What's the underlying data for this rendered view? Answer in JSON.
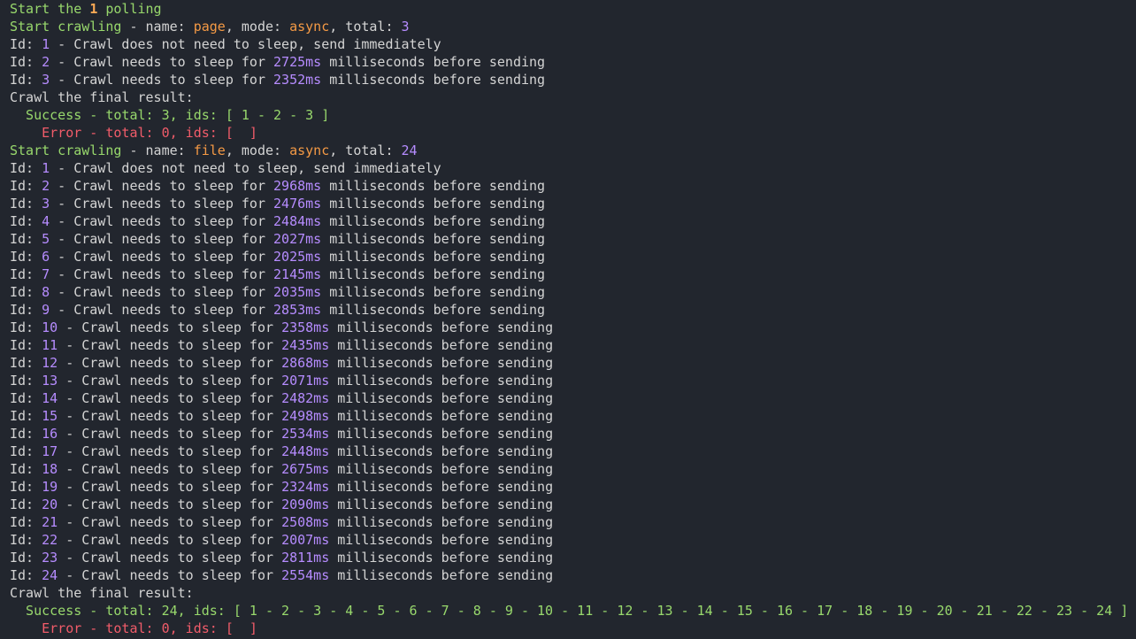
{
  "terminal": {
    "lines": [
      [
        [
          "Start the ",
          "green"
        ],
        [
          "1",
          "orange"
        ],
        [
          " polling",
          "green"
        ]
      ],
      [
        [
          "Start crawling",
          "green"
        ],
        [
          " - name: ",
          "plain"
        ],
        [
          "page",
          "orange-plain"
        ],
        [
          ", mode: ",
          "plain"
        ],
        [
          "async",
          "orange-plain"
        ],
        [
          ", total: ",
          "plain"
        ],
        [
          "3",
          "purple"
        ]
      ],
      [
        [
          "Id: ",
          "plain"
        ],
        [
          "1",
          "purple"
        ],
        [
          " - Crawl does not need to sleep, send immediately",
          "plain"
        ]
      ],
      [
        [
          "Id: ",
          "plain"
        ],
        [
          "2",
          "purple"
        ],
        [
          " - Crawl needs to sleep for ",
          "plain"
        ],
        [
          "2725ms",
          "purple"
        ],
        [
          " milliseconds before sending",
          "plain"
        ]
      ],
      [
        [
          "Id: ",
          "plain"
        ],
        [
          "3",
          "purple"
        ],
        [
          " - Crawl needs to sleep for ",
          "plain"
        ],
        [
          "2352ms",
          "purple"
        ],
        [
          " milliseconds before sending",
          "plain"
        ]
      ],
      [
        [
          "Crawl the final result:",
          "plain"
        ]
      ],
      [
        [
          "  Success - total: 3, ids: [ 1 - 2 - 3 ]",
          "green"
        ]
      ],
      [
        [
          "    Error - total: 0, ids: [  ]",
          "red"
        ]
      ],
      [
        [
          "Start crawling",
          "green"
        ],
        [
          " - name: ",
          "plain"
        ],
        [
          "file",
          "orange-plain"
        ],
        [
          ", mode: ",
          "plain"
        ],
        [
          "async",
          "orange-plain"
        ],
        [
          ", total: ",
          "plain"
        ],
        [
          "24",
          "purple"
        ]
      ],
      [
        [
          "Id: ",
          "plain"
        ],
        [
          "1",
          "purple"
        ],
        [
          " - Crawl does not need to sleep, send immediately",
          "plain"
        ]
      ],
      [
        [
          "Id: ",
          "plain"
        ],
        [
          "2",
          "purple"
        ],
        [
          " - Crawl needs to sleep for ",
          "plain"
        ],
        [
          "2968ms",
          "purple"
        ],
        [
          " milliseconds before sending",
          "plain"
        ]
      ],
      [
        [
          "Id: ",
          "plain"
        ],
        [
          "3",
          "purple"
        ],
        [
          " - Crawl needs to sleep for ",
          "plain"
        ],
        [
          "2476ms",
          "purple"
        ],
        [
          " milliseconds before sending",
          "plain"
        ]
      ],
      [
        [
          "Id: ",
          "plain"
        ],
        [
          "4",
          "purple"
        ],
        [
          " - Crawl needs to sleep for ",
          "plain"
        ],
        [
          "2484ms",
          "purple"
        ],
        [
          " milliseconds before sending",
          "plain"
        ]
      ],
      [
        [
          "Id: ",
          "plain"
        ],
        [
          "5",
          "purple"
        ],
        [
          " - Crawl needs to sleep for ",
          "plain"
        ],
        [
          "2027ms",
          "purple"
        ],
        [
          " milliseconds before sending",
          "plain"
        ]
      ],
      [
        [
          "Id: ",
          "plain"
        ],
        [
          "6",
          "purple"
        ],
        [
          " - Crawl needs to sleep for ",
          "plain"
        ],
        [
          "2025ms",
          "purple"
        ],
        [
          " milliseconds before sending",
          "plain"
        ]
      ],
      [
        [
          "Id: ",
          "plain"
        ],
        [
          "7",
          "purple"
        ],
        [
          " - Crawl needs to sleep for ",
          "plain"
        ],
        [
          "2145ms",
          "purple"
        ],
        [
          " milliseconds before sending",
          "plain"
        ]
      ],
      [
        [
          "Id: ",
          "plain"
        ],
        [
          "8",
          "purple"
        ],
        [
          " - Crawl needs to sleep for ",
          "plain"
        ],
        [
          "2035ms",
          "purple"
        ],
        [
          " milliseconds before sending",
          "plain"
        ]
      ],
      [
        [
          "Id: ",
          "plain"
        ],
        [
          "9",
          "purple"
        ],
        [
          " - Crawl needs to sleep for ",
          "plain"
        ],
        [
          "2853ms",
          "purple"
        ],
        [
          " milliseconds before sending",
          "plain"
        ]
      ],
      [
        [
          "Id: ",
          "plain"
        ],
        [
          "10",
          "purple"
        ],
        [
          " - Crawl needs to sleep for ",
          "plain"
        ],
        [
          "2358ms",
          "purple"
        ],
        [
          " milliseconds before sending",
          "plain"
        ]
      ],
      [
        [
          "Id: ",
          "plain"
        ],
        [
          "11",
          "purple"
        ],
        [
          " - Crawl needs to sleep for ",
          "plain"
        ],
        [
          "2435ms",
          "purple"
        ],
        [
          " milliseconds before sending",
          "plain"
        ]
      ],
      [
        [
          "Id: ",
          "plain"
        ],
        [
          "12",
          "purple"
        ],
        [
          " - Crawl needs to sleep for ",
          "plain"
        ],
        [
          "2868ms",
          "purple"
        ],
        [
          " milliseconds before sending",
          "plain"
        ]
      ],
      [
        [
          "Id: ",
          "plain"
        ],
        [
          "13",
          "purple"
        ],
        [
          " - Crawl needs to sleep for ",
          "plain"
        ],
        [
          "2071ms",
          "purple"
        ],
        [
          " milliseconds before sending",
          "plain"
        ]
      ],
      [
        [
          "Id: ",
          "plain"
        ],
        [
          "14",
          "purple"
        ],
        [
          " - Crawl needs to sleep for ",
          "plain"
        ],
        [
          "2482ms",
          "purple"
        ],
        [
          " milliseconds before sending",
          "plain"
        ]
      ],
      [
        [
          "Id: ",
          "plain"
        ],
        [
          "15",
          "purple"
        ],
        [
          " - Crawl needs to sleep for ",
          "plain"
        ],
        [
          "2498ms",
          "purple"
        ],
        [
          " milliseconds before sending",
          "plain"
        ]
      ],
      [
        [
          "Id: ",
          "plain"
        ],
        [
          "16",
          "purple"
        ],
        [
          " - Crawl needs to sleep for ",
          "plain"
        ],
        [
          "2534ms",
          "purple"
        ],
        [
          " milliseconds before sending",
          "plain"
        ]
      ],
      [
        [
          "Id: ",
          "plain"
        ],
        [
          "17",
          "purple"
        ],
        [
          " - Crawl needs to sleep for ",
          "plain"
        ],
        [
          "2448ms",
          "purple"
        ],
        [
          " milliseconds before sending",
          "plain"
        ]
      ],
      [
        [
          "Id: ",
          "plain"
        ],
        [
          "18",
          "purple"
        ],
        [
          " - Crawl needs to sleep for ",
          "plain"
        ],
        [
          "2675ms",
          "purple"
        ],
        [
          " milliseconds before sending",
          "plain"
        ]
      ],
      [
        [
          "Id: ",
          "plain"
        ],
        [
          "19",
          "purple"
        ],
        [
          " - Crawl needs to sleep for ",
          "plain"
        ],
        [
          "2324ms",
          "purple"
        ],
        [
          " milliseconds before sending",
          "plain"
        ]
      ],
      [
        [
          "Id: ",
          "plain"
        ],
        [
          "20",
          "purple"
        ],
        [
          " - Crawl needs to sleep for ",
          "plain"
        ],
        [
          "2090ms",
          "purple"
        ],
        [
          " milliseconds before sending",
          "plain"
        ]
      ],
      [
        [
          "Id: ",
          "plain"
        ],
        [
          "21",
          "purple"
        ],
        [
          " - Crawl needs to sleep for ",
          "plain"
        ],
        [
          "2508ms",
          "purple"
        ],
        [
          " milliseconds before sending",
          "plain"
        ]
      ],
      [
        [
          "Id: ",
          "plain"
        ],
        [
          "22",
          "purple"
        ],
        [
          " - Crawl needs to sleep for ",
          "plain"
        ],
        [
          "2007ms",
          "purple"
        ],
        [
          " milliseconds before sending",
          "plain"
        ]
      ],
      [
        [
          "Id: ",
          "plain"
        ],
        [
          "23",
          "purple"
        ],
        [
          " - Crawl needs to sleep for ",
          "plain"
        ],
        [
          "2811ms",
          "purple"
        ],
        [
          " milliseconds before sending",
          "plain"
        ]
      ],
      [
        [
          "Id: ",
          "plain"
        ],
        [
          "24",
          "purple"
        ],
        [
          " - Crawl needs to sleep for ",
          "plain"
        ],
        [
          "2554ms",
          "purple"
        ],
        [
          " milliseconds before sending",
          "plain"
        ]
      ],
      [
        [
          "Crawl the final result:",
          "plain"
        ]
      ],
      [
        [
          "  Success - total: 24, ids: [ 1 - 2 - 3 - 4 - 5 - 6 - 7 - 8 - 9 - 10 - 11 - 12 - 13 - 14 - 15 - 16 - 17 - 18 - 19 - 20 - 21 - 22 - 23 - 24 ]",
          "green"
        ]
      ],
      [
        [
          "    Error - total: 0, ids: [  ]",
          "red"
        ]
      ]
    ]
  },
  "colors": {
    "background": "#22262e",
    "text": "#d4d4d4",
    "green": "#98d86c",
    "red": "#f25c6a",
    "orange": "#ffaa55",
    "purple": "#b68cff"
  }
}
